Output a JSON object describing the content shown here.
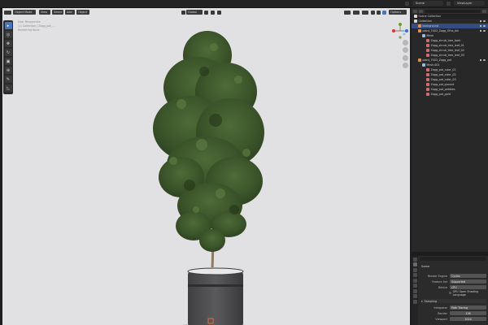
{
  "topbar": {
    "scene": "Scene",
    "view_layer": "ViewLayer"
  },
  "viewport": {
    "mode": "Object Mode",
    "menus": [
      "View",
      "Select",
      "Add",
      "Object"
    ],
    "transform": "Global",
    "shading": "Options",
    "info": [
      "User Perspective",
      "(1) Collection | Zagg_pot_...",
      "Rendering Done"
    ]
  },
  "outliner": {
    "title": "Scene Collection",
    "items": [
      {
        "label": "Collection",
        "level": 0,
        "color": "#d8d8d8",
        "selected": false
      },
      {
        "label": "background",
        "level": 1,
        "color": "#e09050",
        "selected": true
      },
      {
        "label": "plant_7003_Zagg_Ofno_bik",
        "level": 1,
        "color": "#e09050",
        "selected": false
      },
      {
        "label": "Mesh",
        "level": 2,
        "color": "#9ab8e0",
        "selected": false
      },
      {
        "label": "Zagg_shrub_tree_bark",
        "level": 3,
        "color": "#cc6e6e",
        "selected": false
      },
      {
        "label": "Zagg_shrub_tree_leaf_01",
        "level": 3,
        "color": "#cc6e6e",
        "selected": false
      },
      {
        "label": "Zagg_shrub_tree_leaf_02",
        "level": 3,
        "color": "#cc6e6e",
        "selected": false
      },
      {
        "label": "Zagg_shrub_tree_leaf_03",
        "level": 3,
        "color": "#cc6e6e",
        "selected": false
      },
      {
        "label": "plant_7003_Zagg_pot",
        "level": 1,
        "color": "#e09050",
        "selected": false
      },
      {
        "label": "Mesh.001",
        "level": 2,
        "color": "#9ab8e0",
        "selected": false
      },
      {
        "label": "Zagg_pot_color_01",
        "level": 3,
        "color": "#cc6e6e",
        "selected": false
      },
      {
        "label": "Zagg_pot_color_02",
        "level": 3,
        "color": "#cc6e6e",
        "selected": false
      },
      {
        "label": "Zagg_pot_color_03",
        "level": 3,
        "color": "#cc6e6e",
        "selected": false
      },
      {
        "label": "Zagg_pot_ground",
        "level": 3,
        "color": "#cc6e6e",
        "selected": false
      },
      {
        "label": "Zagg_pot_pebbles",
        "level": 3,
        "color": "#cc6e6e",
        "selected": false
      },
      {
        "label": "Zagg_pot_gold",
        "level": 3,
        "color": "#cc6e6e",
        "selected": false
      }
    ]
  },
  "properties": {
    "section": "Scene",
    "rows": [
      {
        "label": "Render Engine",
        "value": "Cycles"
      },
      {
        "label": "Feature Set",
        "value": "Supported"
      },
      {
        "label": "Device",
        "value": "CPU"
      }
    ],
    "checkbox": "GPU Open Shading Language",
    "subsection": "Sampling",
    "sampling_rows": [
      {
        "label": "Integrator",
        "value": "Path Tracing"
      },
      {
        "label": "Render",
        "value": "128"
      },
      {
        "label": "Viewport",
        "value": "1024"
      }
    ]
  }
}
